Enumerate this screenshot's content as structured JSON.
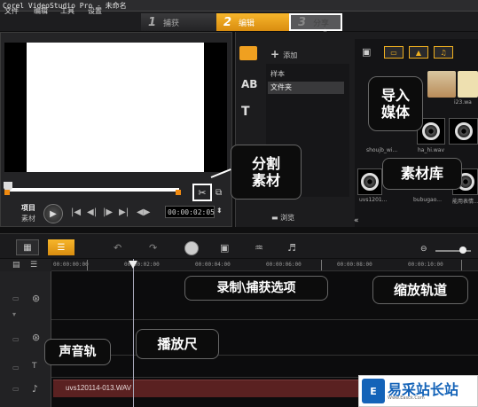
{
  "app": {
    "title": "Corel VideoStudio Pro - 未命名"
  },
  "menu": {
    "items": [
      "文件",
      "编辑",
      "工具",
      "设置"
    ]
  },
  "steps": [
    {
      "num": "1",
      "label": "捕获"
    },
    {
      "num": "2",
      "label": "编辑"
    },
    {
      "num": "3",
      "label": "分享"
    }
  ],
  "preview": {
    "project_label": "项目",
    "clip_label": "素材",
    "timecode": "00:00:02:05",
    "controls": [
      "|◀",
      "◀|",
      "|▶",
      "▶|",
      "◀▶"
    ]
  },
  "library": {
    "add_label": "添加",
    "folders": [
      "样本",
      "文件夹"
    ],
    "browse_label": "浏览",
    "thumbnail_captions": [
      "",
      "",
      "i23.wa",
      "shoujb_wi...",
      "ha_hi.wav",
      "",
      "uvs1201...",
      "bubugao...",
      "能用表情..."
    ],
    "sidebar_letters": [
      "AB",
      "T"
    ]
  },
  "timeline": {
    "ruler_ticks": [
      "00:00:00:00",
      "00:00:02:00",
      "00:00:04:00",
      "00:00:06:00",
      "00:00:08:00",
      "00:00:10:00"
    ],
    "audio_clip_label": "uvs120114-013.WAV"
  },
  "callouts": {
    "import_media": "导入\n媒体",
    "media_library": "素材库",
    "split_clip": "分割\n素材",
    "record_capture_options": "录制\\捕获选项",
    "zoom_track": "缩放轨道",
    "scrubber": "播放尺",
    "audio_track": "声音轨"
  },
  "watermark": {
    "text": "易采站长站",
    "url": "Www.Easck.Com"
  },
  "colors": {
    "accent": "#f0a020",
    "audio_clip": "#5a2121"
  }
}
